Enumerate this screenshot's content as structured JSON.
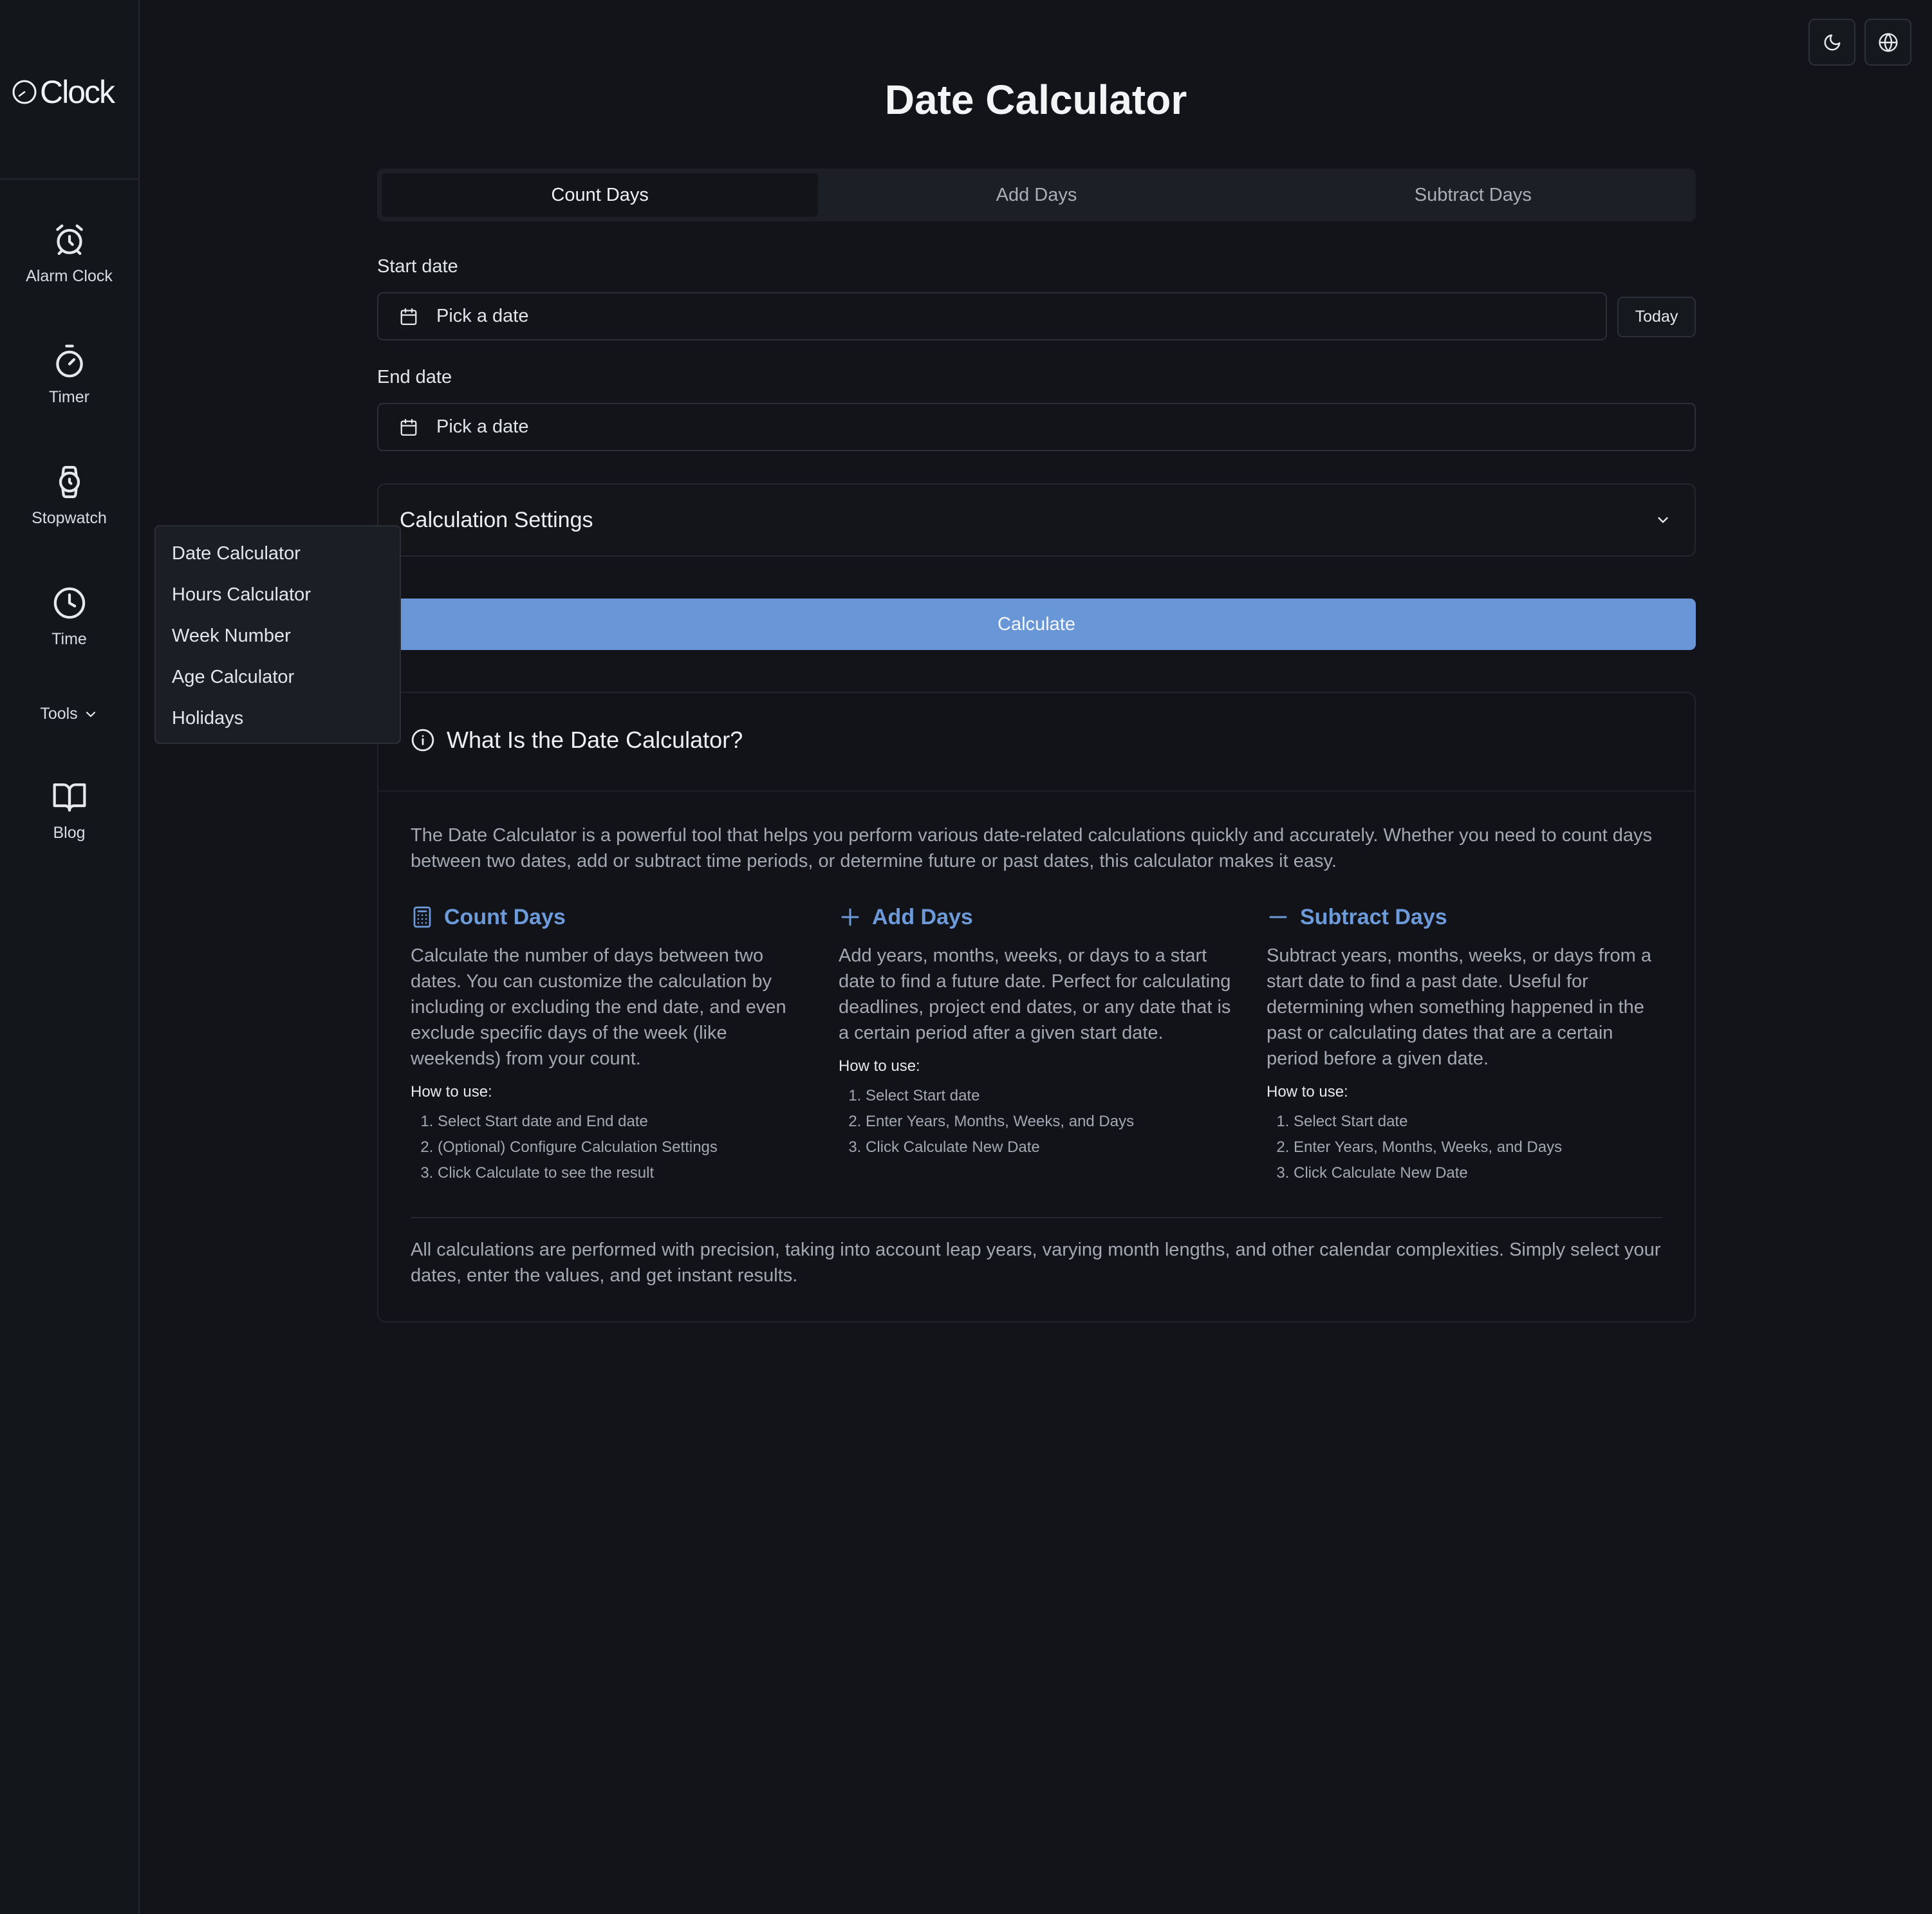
{
  "sidebar": {
    "logo": "Clock",
    "items": [
      {
        "label": "Alarm Clock",
        "icon": "alarm-clock-icon"
      },
      {
        "label": "Timer",
        "icon": "timer-icon"
      },
      {
        "label": "Stopwatch",
        "icon": "stopwatch-icon"
      },
      {
        "label": "Time",
        "icon": "clock-icon"
      }
    ],
    "tools_label": "Tools",
    "blog_label": "Blog"
  },
  "tools_menu": [
    "Date Calculator",
    "Hours Calculator",
    "Week Number",
    "Age Calculator",
    "Holidays"
  ],
  "header": {
    "title": "Date Calculator"
  },
  "tabs": [
    {
      "label": "Count Days",
      "active": true
    },
    {
      "label": "Add Days",
      "active": false
    },
    {
      "label": "Subtract Days",
      "active": false
    }
  ],
  "form": {
    "start_label": "Start date",
    "start_placeholder": "Pick a date",
    "today_label": "Today",
    "end_label": "End date",
    "end_placeholder": "Pick a date",
    "settings_label": "Calculation Settings",
    "calculate_label": "Calculate"
  },
  "info": {
    "title": "What Is the Date Calculator?",
    "intro": "The Date Calculator is a powerful tool that helps you perform various date-related calculations quickly and accurately. Whether you need to count days between two dates, add or subtract time periods, or determine future or past dates, this calculator makes it easy.",
    "columns": [
      {
        "title": "Count Days",
        "icon": "calculator-icon",
        "desc": "Calculate the number of days between two dates. You can customize the calculation by including or excluding the end date, and even exclude specific days of the week (like weekends) from your count.",
        "howto": "How to use:",
        "steps": [
          "Select Start date and End date",
          "(Optional) Configure Calculation Settings",
          "Click Calculate to see the result"
        ]
      },
      {
        "title": "Add Days",
        "icon": "plus-icon",
        "desc": "Add years, months, weeks, or days to a start date to find a future date. Perfect for calculating deadlines, project end dates, or any date that is a certain period after a given start date.",
        "howto": "How to use:",
        "steps": [
          "Select Start date",
          "Enter Years, Months, Weeks, and Days",
          "Click Calculate New Date"
        ]
      },
      {
        "title": "Subtract Days",
        "icon": "minus-icon",
        "desc": "Subtract years, months, weeks, or days from a start date to find a past date. Useful for determining when something happened in the past or calculating dates that are a certain period before a given date.",
        "howto": "How to use:",
        "steps": [
          "Select Start date",
          "Enter Years, Months, Weeks, and Days",
          "Click Calculate New Date"
        ]
      }
    ],
    "footer": "All calculations are performed with precision, taking into account leap years, varying month lengths, and other calendar complexities. Simply select your dates, enter the values, and get instant results."
  },
  "colors": {
    "accent": "#6996d6",
    "background": "#121419"
  }
}
